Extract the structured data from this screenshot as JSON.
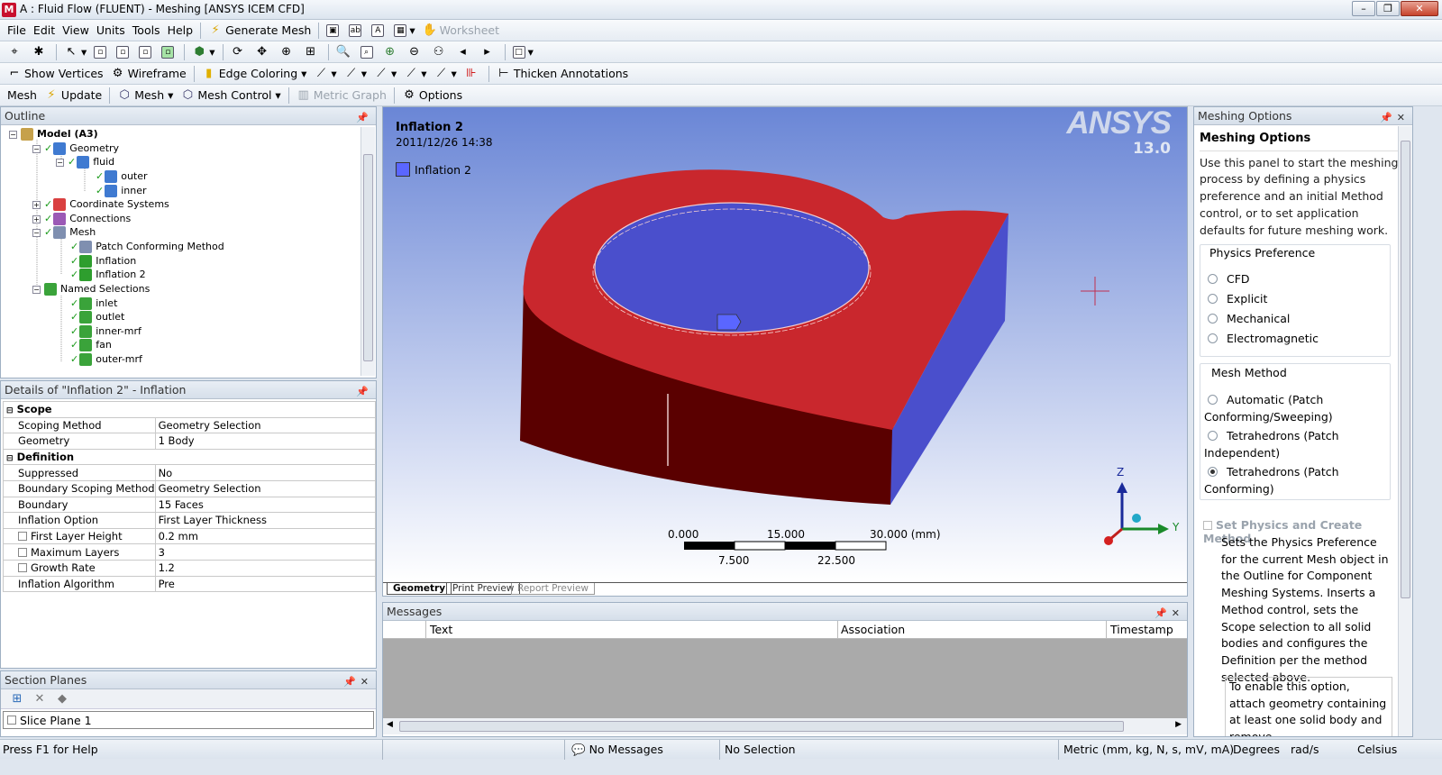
{
  "window": {
    "title": "A : Fluid Flow (FLUENT) - Meshing [ANSYS ICEM CFD]"
  },
  "menu": [
    "File",
    "Edit",
    "View",
    "Units",
    "Tools",
    "Help"
  ],
  "toolbar1": {
    "generate_mesh": "Generate Mesh",
    "worksheet": "Worksheet"
  },
  "toolbar3": {
    "show_vertices": "Show Vertices",
    "wireframe": "Wireframe",
    "edge_coloring": "Edge Coloring",
    "thicken_annotations": "Thicken Annotations"
  },
  "toolbar4": {
    "mesh": "Mesh",
    "update": "Update",
    "mesh_menu": "Mesh",
    "mesh_control": "Mesh Control",
    "metric_graph": "Metric Graph",
    "options": "Options"
  },
  "outline": {
    "header": "Outline",
    "nodes": [
      "Model (A3)",
      "Geometry",
      "fluid",
      "outer",
      "inner",
      "Coordinate Systems",
      "Connections",
      "Mesh",
      "Patch Conforming Method",
      "Inflation",
      "Inflation 2",
      "Named Selections",
      "inlet",
      "outlet",
      "inner-mrf",
      "fan",
      "outer-mrf"
    ]
  },
  "details": {
    "header": "Details of \"Inflation 2\" - Inflation",
    "rows": [
      {
        "section": "Scope"
      },
      {
        "label": "Scoping Method",
        "value": "Geometry Selection"
      },
      {
        "label": "Geometry",
        "value": "1 Body"
      },
      {
        "section": "Definition"
      },
      {
        "label": "Suppressed",
        "value": "No"
      },
      {
        "label": "Boundary Scoping Method",
        "value": "Geometry Selection"
      },
      {
        "label": "Boundary",
        "value": "15 Faces"
      },
      {
        "label": "Inflation Option",
        "value": "First Layer Thickness"
      },
      {
        "label": "First Layer Height",
        "value": "0.2 mm",
        "checkbox": true
      },
      {
        "label": "Maximum Layers",
        "value": "3",
        "checkbox": true
      },
      {
        "label": "Growth Rate",
        "value": "1.2",
        "checkbox": true
      },
      {
        "label": "Inflation Algorithm",
        "value": "Pre"
      }
    ]
  },
  "section_planes": {
    "header": "Section Planes",
    "item": "Slice Plane 1"
  },
  "viewport": {
    "title": "Inflation 2",
    "date": "2011/12/26 14:38",
    "legend": "Inflation 2",
    "logo": "ANSYS",
    "version": "13.0",
    "axis_z": "Z",
    "axis_y": "Y",
    "scale": {
      "top": [
        "0.000",
        "15.000",
        "30.000 (mm)"
      ],
      "bottom": [
        "7.500",
        "22.500"
      ]
    },
    "tabs": [
      "Geometry",
      "Print Preview",
      "Report Preview"
    ],
    "colors": {
      "bg_top": "#6a86d6",
      "bg_bottom": "#ffffff",
      "red_face": "#c9272d",
      "dark_red": "#5a0000",
      "blue": "#4a4fcc"
    }
  },
  "messages": {
    "header": "Messages",
    "cols": [
      "Text",
      "Association",
      "Timestamp"
    ]
  },
  "meshing_options": {
    "header": "Meshing Options",
    "title": "Meshing Options",
    "intro": "Use this panel to start the meshing process by defining a physics preference and an initial Method control, or to set application defaults for future meshing work.",
    "physics_title": "Physics Preference",
    "physics": [
      "CFD",
      "Explicit",
      "Mechanical",
      "Electromagnetic"
    ],
    "method_title": "Mesh Method",
    "methods": [
      "Automatic (Patch Conforming/Sweeping)",
      "Tetrahedrons (Patch Independent)",
      "Tetrahedrons (Patch Conforming)"
    ],
    "set_physics": "Set Physics and Create Method",
    "set_physics_desc": "Sets the Physics Preference for the current Mesh object in the Outline for Component Meshing Systems. Inserts a Method control, sets the Scope selection to all solid bodies and configures the Definition per the method selected above.",
    "enable_note": "To enable this option, attach geometry containing at least one solid body and remove"
  },
  "status": {
    "help": "Press F1 for Help",
    "messages": "No Messages",
    "selection": "No Selection",
    "units": "Metric (mm, kg, N, s, mV, mA)",
    "degrees": "Degrees",
    "rads": "rad/s",
    "temp": "Celsius"
  }
}
